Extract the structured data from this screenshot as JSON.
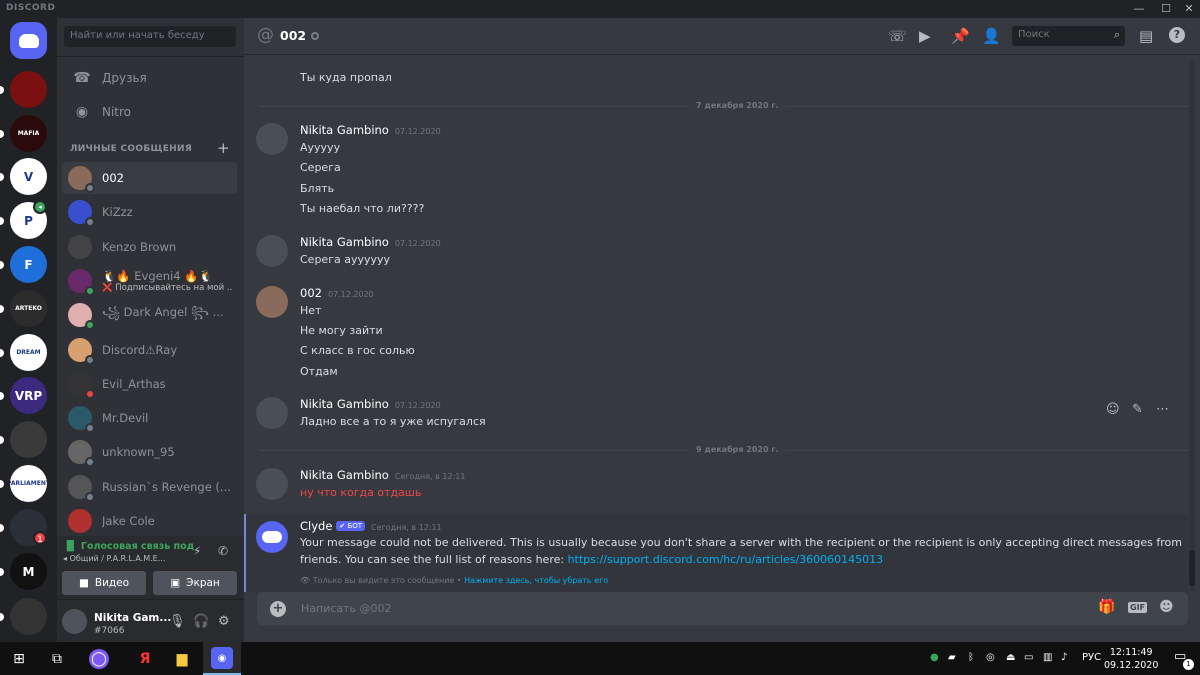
{
  "app": {
    "brand": "DISCORD"
  },
  "window": {
    "minimize": "—",
    "maximize": "☐",
    "close": "✕"
  },
  "guilds": [
    {
      "name": "home",
      "label": "",
      "color": "#5865f2"
    },
    {
      "name": "sith",
      "label": "",
      "color": "#7a1010"
    },
    {
      "name": "mafia",
      "label": "MAFIA",
      "color": "#2a0a0a"
    },
    {
      "name": "vrp",
      "label": "V",
      "color": "#ffffff"
    },
    {
      "name": "p-server",
      "label": "P",
      "color": "#ffffff"
    },
    {
      "name": "f-server",
      "label": "F",
      "color": "#1e6fd9"
    },
    {
      "name": "arteko",
      "label": "ARTEKO",
      "color": "#2c2c2c"
    },
    {
      "name": "dream-team",
      "label": "DREAM",
      "color": "#ffffff"
    },
    {
      "name": "vrp2",
      "label": "VRP",
      "color": "#3b2a80"
    },
    {
      "name": "dark",
      "label": "",
      "color": "#3a3a3a"
    },
    {
      "name": "parliament",
      "label": "PARLIAMENT",
      "color": "#ffffff"
    },
    {
      "name": "wheel",
      "label": "",
      "color": "#2a2f3a"
    },
    {
      "name": "m-squad",
      "label": "M",
      "color": "#111111"
    },
    {
      "name": "group",
      "label": "",
      "color": "#333333"
    }
  ],
  "guild_badge": "1",
  "sidebar": {
    "search_placeholder": "Найти или начать беседу",
    "friends": "Друзья",
    "nitro": "Nitro",
    "dm_header": "ЛИЧНЫЕ СООБЩЕНИЯ",
    "dm_add": "+",
    "dms": [
      {
        "name": "002",
        "sub": "",
        "color": "#8a6a5a",
        "status": "#747f8d",
        "active": true
      },
      {
        "name": "KiZzz",
        "sub": "",
        "color": "#3a4fd0",
        "status": "#747f8d"
      },
      {
        "name": "Kenzo Brown",
        "sub": "",
        "color": "#444444",
        "status": ""
      },
      {
        "name": "🐧🔥 Evgeni4 🔥🐧",
        "sub": "❌ Подписывайтесь на мой ...",
        "color": "#6a2a6a",
        "status": "#3ba55d"
      },
      {
        "name": "꧁ Dark Angel ꧂ ...",
        "sub": "",
        "color": "#e0b0b0",
        "status": "#3ba55d"
      },
      {
        "name": "Discord⚠Ray",
        "sub": "",
        "color": "#d8a070",
        "status": "#747f8d"
      },
      {
        "name": "Evil_Arthas",
        "sub": "",
        "color": "#333333",
        "status": "#ed4245"
      },
      {
        "name": "Mr.Devil",
        "sub": "",
        "color": "#2a5a6a",
        "status": "#747f8d"
      },
      {
        "name": "unknown_95",
        "sub": "",
        "color": "#666666",
        "status": "#747f8d"
      },
      {
        "name": "Russian`s Revenge (...",
        "sub": "",
        "color": "#555555",
        "status": "#747f8d"
      },
      {
        "name": "Jake Cole",
        "sub": "",
        "color": "#b03030",
        "status": ""
      }
    ],
    "voice": {
      "status": "Голосовая связь под",
      "channel": "Общий / P.A.R.L.A.M.E...",
      "video_btn": "Видео",
      "screen_btn": "Экран"
    },
    "user": {
      "name": "Nikita Gam...",
      "tag": "#7066"
    }
  },
  "header": {
    "title": "002",
    "search_placeholder": "Поиск"
  },
  "messages": {
    "top_line": "Ты куда пропал",
    "date1": "7 декабря 2020 г.",
    "date2": "9 декабря 2020 г.",
    "groups": [
      {
        "author": "Nikita Gambino",
        "time": "07.12.2020",
        "lines": [
          "Ауyyyy",
          "Серега",
          "Блять",
          "Ты наебал что ли????"
        ]
      },
      {
        "author": "Nikita Gambino",
        "time": "07.12.2020",
        "lines": [
          "Серега аyyyyyy"
        ]
      },
      {
        "author": "002",
        "time": "07.12.2020",
        "lines": [
          "Нет",
          "Не могу зайти",
          "С класс в гос солью",
          "Отдам"
        ]
      },
      {
        "author": "Nikita Gambino",
        "time": "07.12.2020",
        "lines": [
          "Ладно все а то я уже испугался"
        ]
      },
      {
        "author": "Nikita Gambino",
        "time": "Сегодня, в 12:11",
        "lines": [
          "ну что когда отдашь"
        ]
      }
    ],
    "clyde": {
      "author": "Clyde",
      "tag": "✔ БОТ",
      "time": "Сегодня, в 12:11",
      "line1": "Your message could not be delivered. This is usually because you don't share a server with the recipient or the recipient is only accepting direct messages from",
      "line2": "friends. You can see the full list of reasons here: ",
      "url": "https://support.discord.com/hc/ru/articles/360060145013",
      "note": "Только вы видите это сообщение • ",
      "note_link": "Нажмите здесь, чтобы убрать его"
    },
    "error_color": "#f04747"
  },
  "composer": {
    "placeholder": "Написать @002",
    "gif": "GIF"
  },
  "taskbar": {
    "lang": "РУС",
    "time": "12:11:49",
    "date": "09.12.2020",
    "notif": "1"
  }
}
